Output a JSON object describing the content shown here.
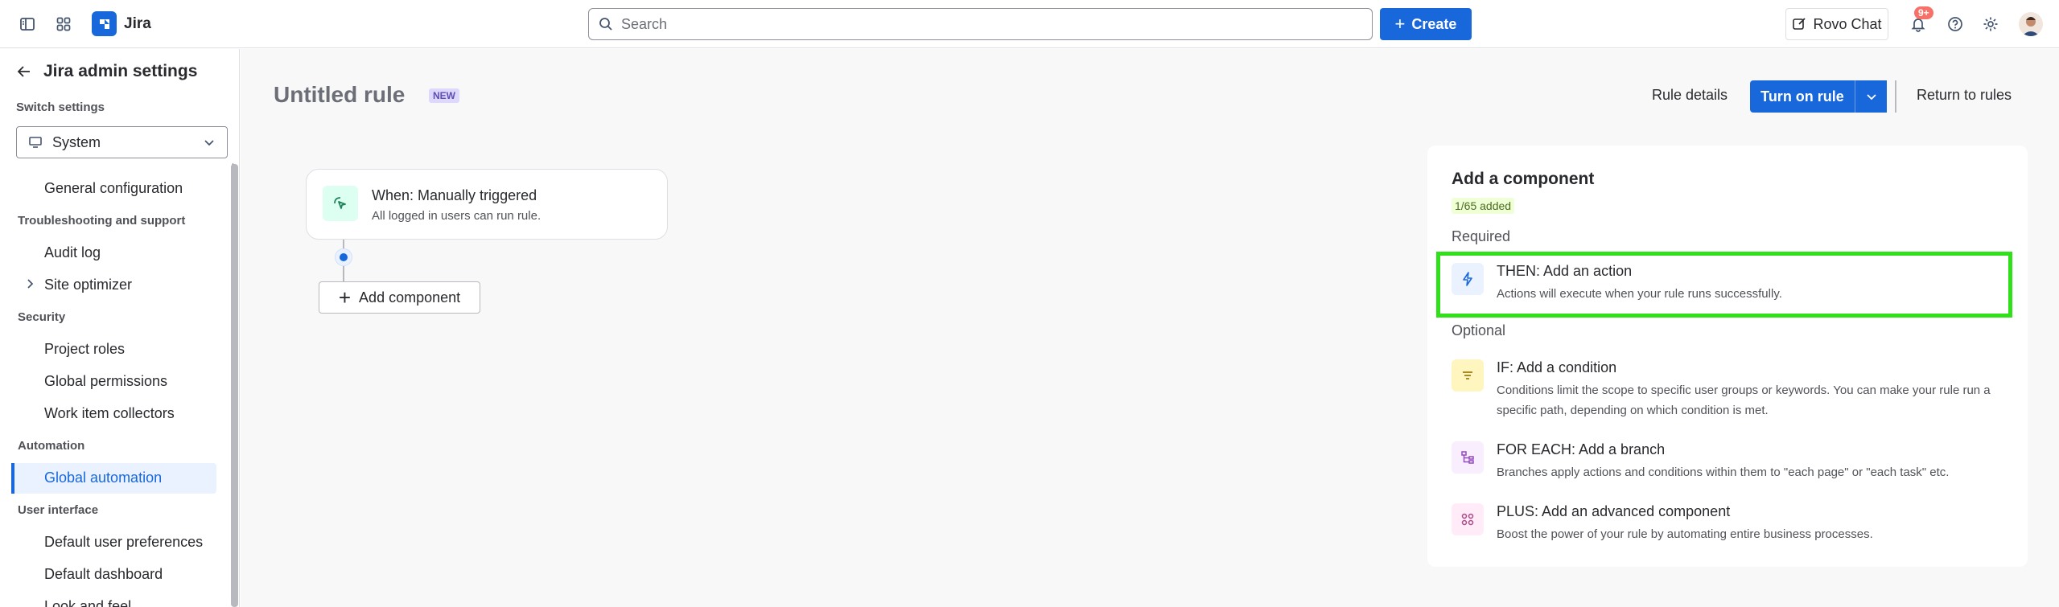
{
  "topbar": {
    "app_name": "Jira",
    "search_placeholder": "Search",
    "create_label": "Create",
    "rovo_label": "Rovo Chat",
    "notification_count": "9+"
  },
  "sidebar": {
    "title": "Jira admin settings",
    "switch_label": "Switch settings",
    "switch_value": "System",
    "items": [
      {
        "type": "item",
        "label": "General configuration"
      },
      {
        "type": "section",
        "label": "Troubleshooting and support"
      },
      {
        "type": "item",
        "label": "Audit log"
      },
      {
        "type": "item",
        "label": "Site optimizer"
      },
      {
        "type": "section",
        "label": "Security"
      },
      {
        "type": "item",
        "label": "Project roles"
      },
      {
        "type": "item",
        "label": "Global permissions"
      },
      {
        "type": "item",
        "label": "Work item collectors"
      },
      {
        "type": "section",
        "label": "Automation"
      },
      {
        "type": "item",
        "label": "Global automation",
        "active": true
      },
      {
        "type": "section",
        "label": "User interface"
      },
      {
        "type": "item",
        "label": "Default user preferences"
      },
      {
        "type": "item",
        "label": "Default dashboard"
      },
      {
        "type": "item",
        "label": "Look and feel"
      }
    ]
  },
  "header": {
    "title": "Untitled rule",
    "lozenge": "NEW",
    "rule_details": "Rule details",
    "turn_on": "Turn on rule",
    "return": "Return to rules"
  },
  "canvas": {
    "trigger_title": "When: Manually triggered",
    "trigger_sub": "All logged in users can run rule.",
    "add_component": "Add component"
  },
  "panel": {
    "title": "Add a component",
    "added": "1/65 added",
    "required_label": "Required",
    "optional_label": "Optional",
    "components": [
      {
        "title": "THEN: Add an action",
        "desc": "Actions will execute when your rule runs successfully."
      },
      {
        "title": "IF: Add a condition",
        "desc": "Conditions limit the scope to specific user groups or keywords. You can make your rule run a specific path, depending on which condition is met."
      },
      {
        "title": "FOR EACH: Add a branch",
        "desc": "Branches apply actions and conditions within them to \"each page\" or \"each task\" etc."
      },
      {
        "title": "PLUS: Add an advanced component",
        "desc": "Boost the power of your rule by automating entire business processes."
      }
    ]
  },
  "colors": {
    "accent": "#1868db",
    "highlight": "#2fe01a"
  }
}
